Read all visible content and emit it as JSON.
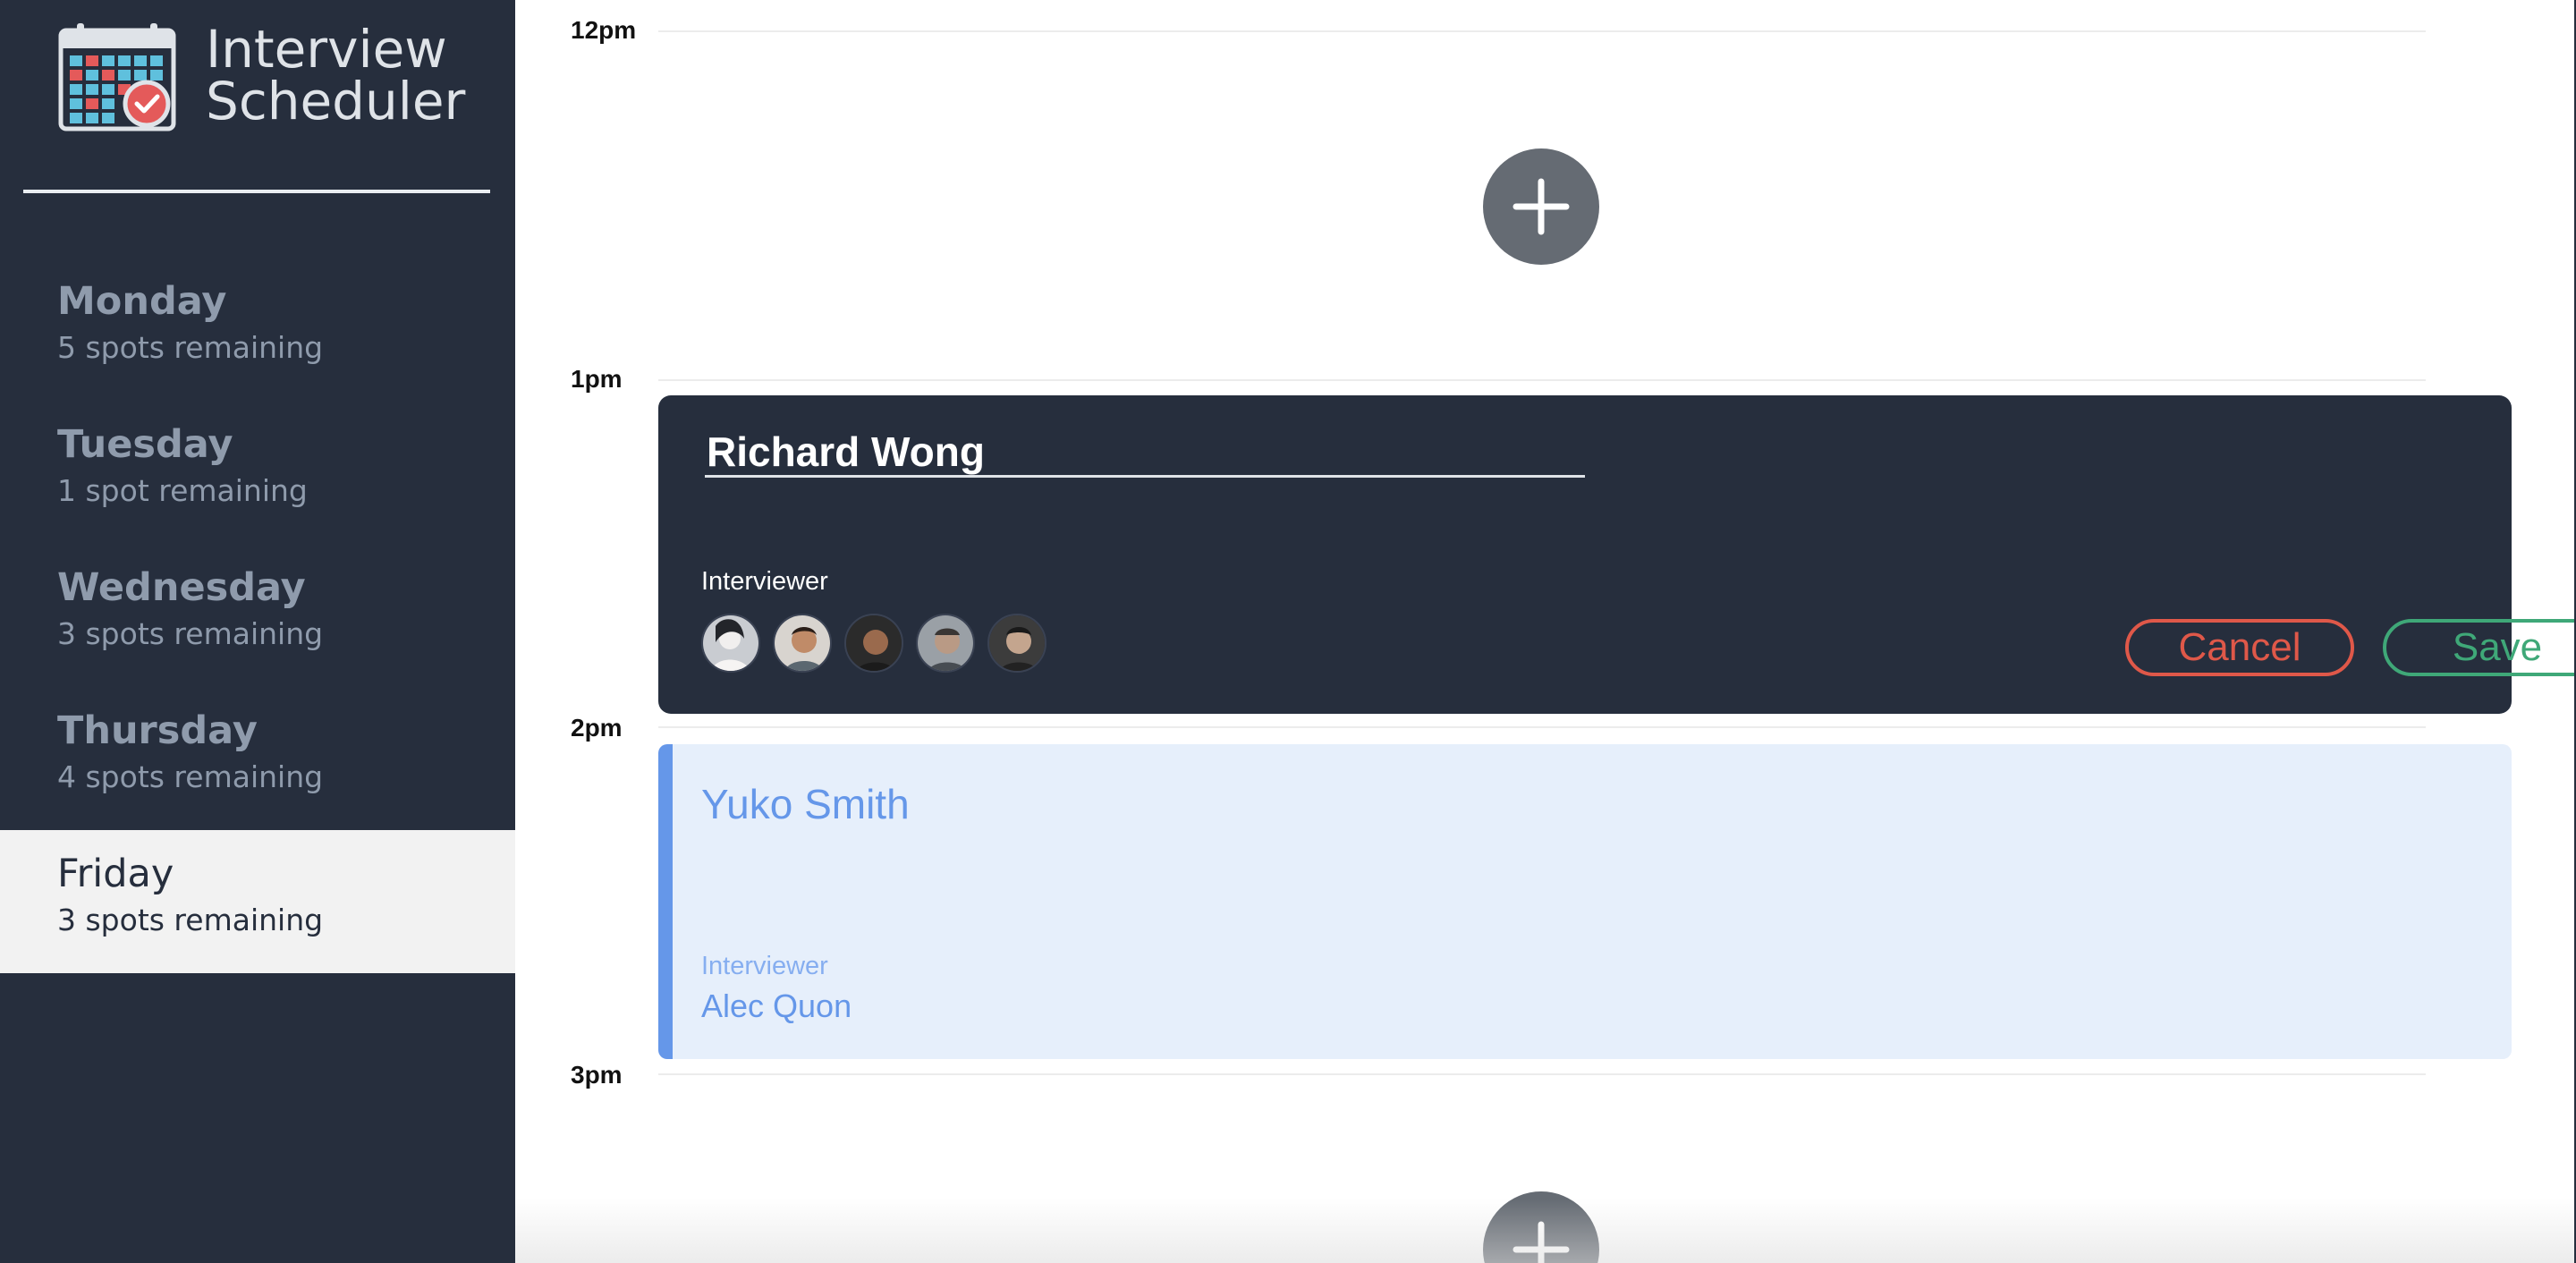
{
  "sidebar": {
    "brand": {
      "line1": "Interview",
      "line2": "Scheduler",
      "logo_icon": "calendar-check-icon"
    },
    "days": [
      {
        "name": "Monday",
        "spots": "5 spots remaining",
        "selected": false
      },
      {
        "name": "Tuesday",
        "spots": "1 spot remaining",
        "selected": false
      },
      {
        "name": "Wednesday",
        "spots": "3 spots remaining",
        "selected": false
      },
      {
        "name": "Thursday",
        "spots": "4 spots remaining",
        "selected": false
      },
      {
        "name": "Friday",
        "spots": "3 spots remaining",
        "selected": true
      }
    ]
  },
  "schedule": {
    "times": [
      "12pm",
      "1pm",
      "2pm",
      "3pm"
    ],
    "form": {
      "student_value": "Richard Wong",
      "interviewer_label": "Interviewer",
      "interviewer_avatars": [
        "avatar-1",
        "avatar-2",
        "avatar-3",
        "avatar-4",
        "avatar-5"
      ],
      "cancel_label": "Cancel",
      "save_label": "Save"
    },
    "appointment": {
      "student": "Yuko Smith",
      "interviewer_label": "Interviewer",
      "interviewer_name": "Alec Quon"
    }
  },
  "colors": {
    "sidebar_bg": "#262e3d",
    "selected_day_bg": "#f2f2f2",
    "cancel": "#df5849",
    "save": "#3fa878",
    "appointment_accent": "#6597e9",
    "appointment_bg": "#e6effb",
    "add_button": "#656b73"
  }
}
